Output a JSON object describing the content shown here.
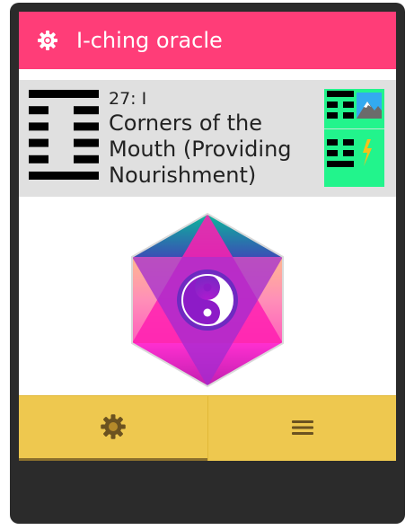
{
  "app_bar": {
    "title": "I-ching oracle",
    "icon": "sun-gear-icon",
    "color": "#ff3d78"
  },
  "hexagram": {
    "number_label": "27: I",
    "name": "Corners of the Mouth (Providing Nourishment)",
    "lines_top_to_bottom": [
      "solid",
      "broken",
      "broken",
      "broken",
      "broken",
      "solid"
    ],
    "upper_trigram": {
      "icon": "mountain-icon",
      "lines": [
        "solid",
        "broken",
        "broken"
      ]
    },
    "lower_trigram": {
      "icon": "lightning-icon",
      "lines": [
        "broken",
        "broken",
        "solid"
      ]
    },
    "trigram_card_color": "#22f48c"
  },
  "oracle": {
    "icon": "yin-yang-icon"
  },
  "bottom_nav": {
    "color": "#eec84f",
    "tabs": [
      {
        "icon": "sun-gear-icon",
        "selected": true
      },
      {
        "icon": "menu-icon",
        "selected": false
      }
    ]
  }
}
